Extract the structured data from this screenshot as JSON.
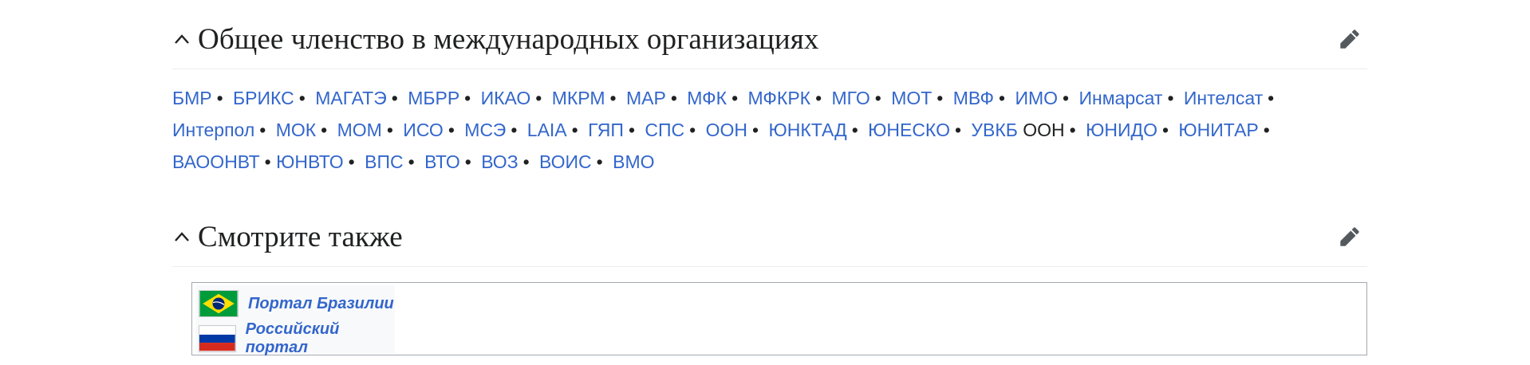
{
  "sections": {
    "membership": {
      "heading": "Общее членство в международных организациях",
      "orgs": [
        {
          "label": "БМР",
          "link": true
        },
        {
          "label": "БРИКС",
          "link": true
        },
        {
          "label": "МАГАТЭ",
          "link": true
        },
        {
          "label": "МБРР",
          "link": true
        },
        {
          "label": "ИКАО",
          "link": true
        },
        {
          "label": "МКРМ",
          "link": true
        },
        {
          "label": "МАР",
          "link": true
        },
        {
          "label": "МФК",
          "link": true
        },
        {
          "label": "МФКРК",
          "link": true
        },
        {
          "label": "МГО",
          "link": true
        },
        {
          "label": "МОТ",
          "link": true
        },
        {
          "label": "МВФ",
          "link": true
        },
        {
          "label": "ИМО",
          "link": true
        },
        {
          "label": "Инмарсат",
          "link": true
        },
        {
          "label": "Интелсат",
          "link": true
        },
        {
          "label": "Интерпол",
          "link": true
        },
        {
          "label": "МОК",
          "link": true
        },
        {
          "label": "МОМ",
          "link": true
        },
        {
          "label": "ИСО",
          "link": true
        },
        {
          "label": "МСЭ",
          "link": true
        },
        {
          "label": "LAIA",
          "link": true
        },
        {
          "label": "ГЯП",
          "link": true
        },
        {
          "label": "СПС",
          "link": true
        },
        {
          "label": "ООН",
          "link": true
        },
        {
          "label": "ЮНКТАД",
          "link": true
        },
        {
          "label": "ЮНЕСКО",
          "link": true
        },
        {
          "label": "УВКБ",
          "link": true,
          "suffix": " ООН"
        },
        {
          "label": "ЮНИДО",
          "link": true
        },
        {
          "label": "ЮНИТАР",
          "link": true
        },
        {
          "label": "ВАООНВТ",
          "link": true,
          "tight": true
        },
        {
          "label": "ЮНВТО",
          "link": true
        },
        {
          "label": "ВПС",
          "link": true
        },
        {
          "label": "ВТО",
          "link": true
        },
        {
          "label": "ВОЗ",
          "link": true
        },
        {
          "label": "ВОИС",
          "link": true
        },
        {
          "label": "ВМО",
          "link": true
        }
      ],
      "separator": "•"
    },
    "see_also": {
      "heading": "Смотрите также",
      "portals": [
        {
          "label": "Портал Бразилии",
          "flag": "brazil-flag"
        },
        {
          "label": "Российский портал",
          "flag": "russia-flag"
        }
      ]
    }
  },
  "colors": {
    "link": "#3366cc",
    "text": "#202122",
    "divider": "#eaecf0",
    "icon": "#54595d"
  }
}
